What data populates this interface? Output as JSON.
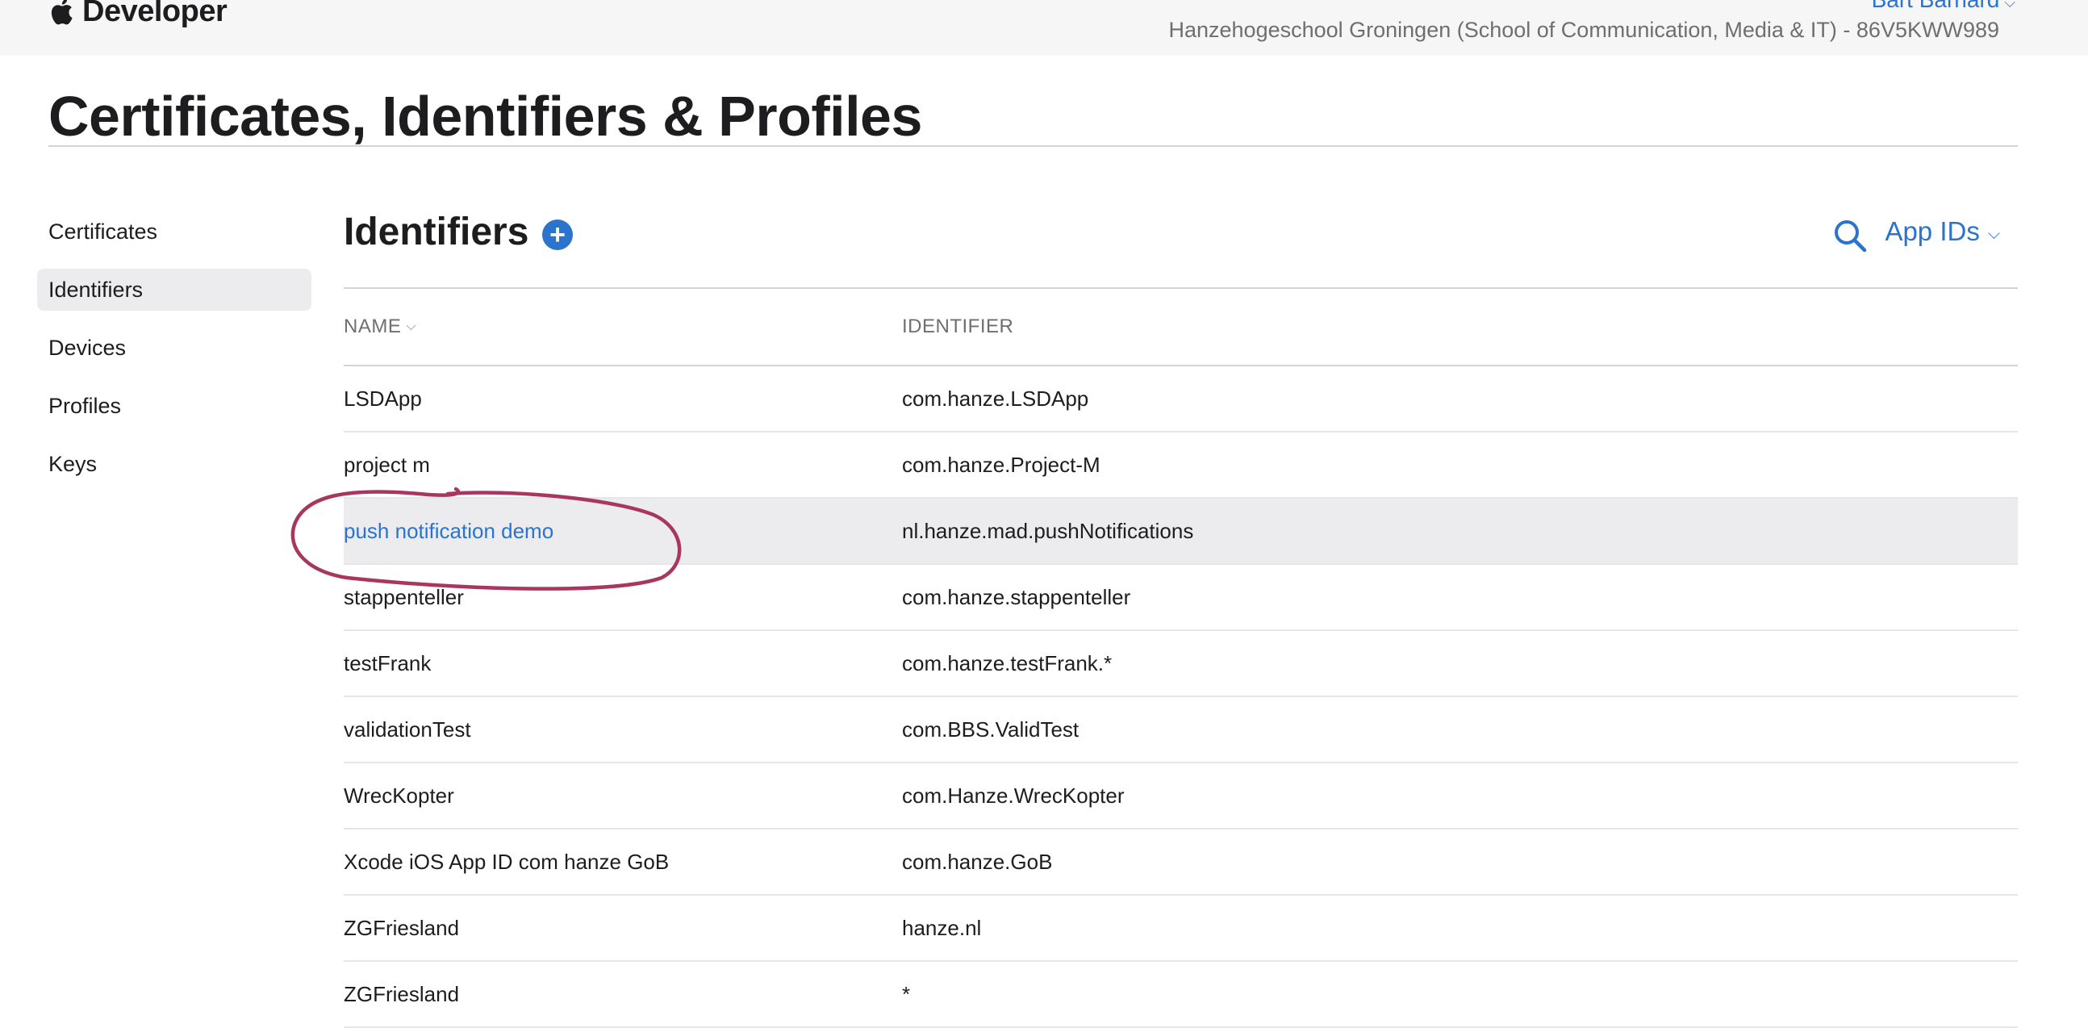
{
  "header": {
    "brand": "Developer",
    "user_name": "Bart Barnard",
    "team": "Hanzehogeschool Groningen (School of Communication, Media & IT) - 86V5KWW989"
  },
  "page_title": "Certificates, Identifiers & Profiles",
  "sidebar": {
    "items": [
      {
        "label": "Certificates",
        "active": false
      },
      {
        "label": "Identifiers",
        "active": true
      },
      {
        "label": "Devices",
        "active": false
      },
      {
        "label": "Profiles",
        "active": false
      },
      {
        "label": "Keys",
        "active": false
      }
    ]
  },
  "main": {
    "title": "Identifiers",
    "add_symbol": "+",
    "filter_label": "App IDs",
    "columns": {
      "name": "NAME",
      "identifier": "IDENTIFIER"
    },
    "rows": [
      {
        "name": "LSDApp",
        "identifier": "com.hanze.LSDApp"
      },
      {
        "name": "project m",
        "identifier": "com.hanze.Project-M"
      },
      {
        "name": "push notification demo",
        "identifier": "nl.hanze.mad.pushNotifications",
        "selected": true
      },
      {
        "name": "stappenteller",
        "identifier": "com.hanze.stappenteller"
      },
      {
        "name": "testFrank",
        "identifier": "com.hanze.testFrank.*"
      },
      {
        "name": "validationTest",
        "identifier": "com.BBS.ValidTest"
      },
      {
        "name": "WrecKopter",
        "identifier": "com.Hanze.WrecKopter"
      },
      {
        "name": "Xcode iOS App ID com hanze GoB",
        "identifier": "com.hanze.GoB"
      },
      {
        "name": "ZGFriesland",
        "identifier": "hanze.nl"
      },
      {
        "name": "ZGFriesland",
        "identifier": "*"
      }
    ]
  },
  "colors": {
    "accent": "#2c73cc",
    "annotation": "#a8365f",
    "selected_row": "#ececee"
  },
  "icons": [
    "apple-logo",
    "add-icon",
    "search-icon",
    "chevron-down-icon"
  ]
}
